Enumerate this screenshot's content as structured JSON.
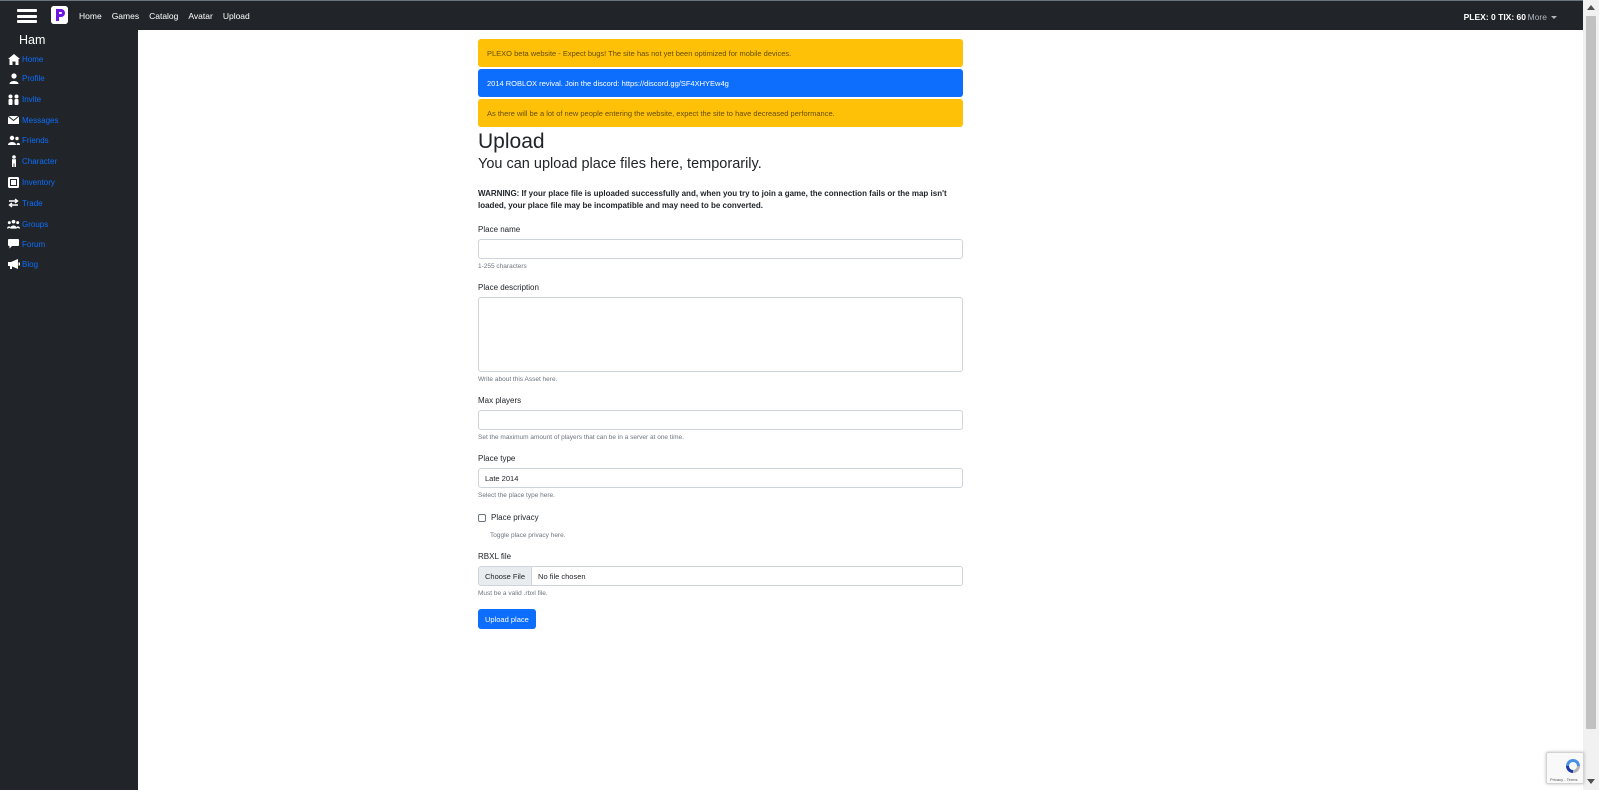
{
  "navbar": {
    "links": [
      "Home",
      "Games",
      "Catalog",
      "Avatar",
      "Upload"
    ],
    "currency": "PLEX: 0 TIX: 60",
    "more_label": "More"
  },
  "sidebar": {
    "username": "Ham",
    "items": [
      {
        "label": "Home",
        "icon": "home-icon"
      },
      {
        "label": "Profile",
        "icon": "user-icon"
      },
      {
        "label": "Invite",
        "icon": "people-icon"
      },
      {
        "label": "Messages",
        "icon": "envelope-icon"
      },
      {
        "label": "Friends",
        "icon": "friends-icon"
      },
      {
        "label": "Character",
        "icon": "character-icon"
      },
      {
        "label": "Inventory",
        "icon": "inventory-icon"
      },
      {
        "label": "Trade",
        "icon": "arrows-icon"
      },
      {
        "label": "Groups",
        "icon": "groups-icon"
      },
      {
        "label": "Forum",
        "icon": "chat-icon"
      },
      {
        "label": "Blog",
        "icon": "megaphone-icon"
      }
    ]
  },
  "alerts": [
    {
      "text": "PLEXO beta website - Expect bugs! The site has not yet been optimized for mobile devices.",
      "type": "warning"
    },
    {
      "text": "2014 ROBLOX revival. Join the discord: https://discord.gg/SF4XHYEw4g",
      "type": "info"
    },
    {
      "text": "As there will be a lot of new people entering the website, expect the site to have decreased performance.",
      "type": "warning"
    }
  ],
  "page": {
    "title": "Upload",
    "subtitle": "You can upload place files here, temporarily.",
    "warning": "WARNING: If your place file is uploaded successfully and, when you try to join a game, the connection fails or the map isn't loaded, your place file may be incompatible and may need to be converted."
  },
  "form": {
    "place_name": {
      "label": "Place name",
      "value": "",
      "help": "1-255 characters"
    },
    "place_description": {
      "label": "Place description",
      "value": "",
      "help": "Write about this Asset here."
    },
    "max_players": {
      "label": "Max players",
      "value": "",
      "help": "Set the maximum amount of players that can be in a server at one time."
    },
    "place_type": {
      "label": "Place type",
      "value": "Late 2014",
      "help": "Select the place type here."
    },
    "place_privacy": {
      "label": "Place privacy",
      "checked": false,
      "help": "Toggle place privacy here."
    },
    "rbxl_file": {
      "label": "RBXL file",
      "button": "Choose File",
      "status": "No file chosen",
      "help": "Must be a valid .rbxl file."
    },
    "submit_label": "Upload place"
  },
  "recaptcha": {
    "text": "Privacy - Terms"
  },
  "colors": {
    "dark": "#212529",
    "primary": "#0d6efd",
    "warning": "#ffc107",
    "warning_text": "#664d03"
  }
}
